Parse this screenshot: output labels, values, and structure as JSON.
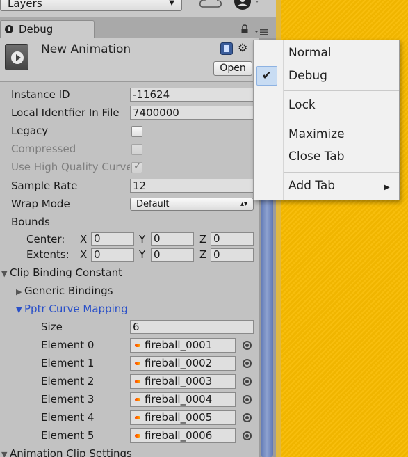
{
  "toolbar": {
    "layers_label": "Layers",
    "cloud_icon": "cloud-icon",
    "account_icon": "account-icon"
  },
  "tab": {
    "title": "Debug"
  },
  "header": {
    "name": "New Animation",
    "open_label": "Open"
  },
  "fields": {
    "instance_id_label": "Instance ID",
    "instance_id_value": "-11624",
    "local_id_label": "Local Identfier In File",
    "local_id_value": "7400000",
    "legacy_label": "Legacy",
    "compressed_label": "Compressed",
    "hq_curve_label": "Use High Quality Curve",
    "sample_rate_label": "Sample Rate",
    "sample_rate_value": "12",
    "wrap_mode_label": "Wrap Mode",
    "wrap_mode_value": "Default",
    "bounds_label": "Bounds",
    "center_label": "Center:",
    "extents_label": "Extents:",
    "x": "X",
    "y": "Y",
    "z": "Z",
    "center": [
      "0",
      "0",
      "0"
    ],
    "extents": [
      "0",
      "0",
      "0"
    ]
  },
  "tree": {
    "clip_binding": "Clip Binding Constant",
    "generic_bindings": "Generic Bindings",
    "pptr_mapping": "Pptr Curve Mapping",
    "size_label": "Size",
    "size_value": "6",
    "elements": [
      {
        "label": "Element 0",
        "value": "fireball_0001"
      },
      {
        "label": "Element 1",
        "value": "fireball_0002"
      },
      {
        "label": "Element 2",
        "value": "fireball_0003"
      },
      {
        "label": "Element 3",
        "value": "fireball_0004"
      },
      {
        "label": "Element 4",
        "value": "fireball_0005"
      },
      {
        "label": "Element 5",
        "value": "fireball_0006"
      }
    ],
    "clip_settings": "Animation Clip Settings"
  },
  "context_menu": {
    "normal": "Normal",
    "debug": "Debug",
    "lock": "Lock",
    "maximize": "Maximize",
    "close_tab": "Close Tab",
    "add_tab": "Add Tab"
  },
  "colors": {
    "scene_bg": "#f8bb00",
    "foldout_active": "#2a50c8"
  }
}
